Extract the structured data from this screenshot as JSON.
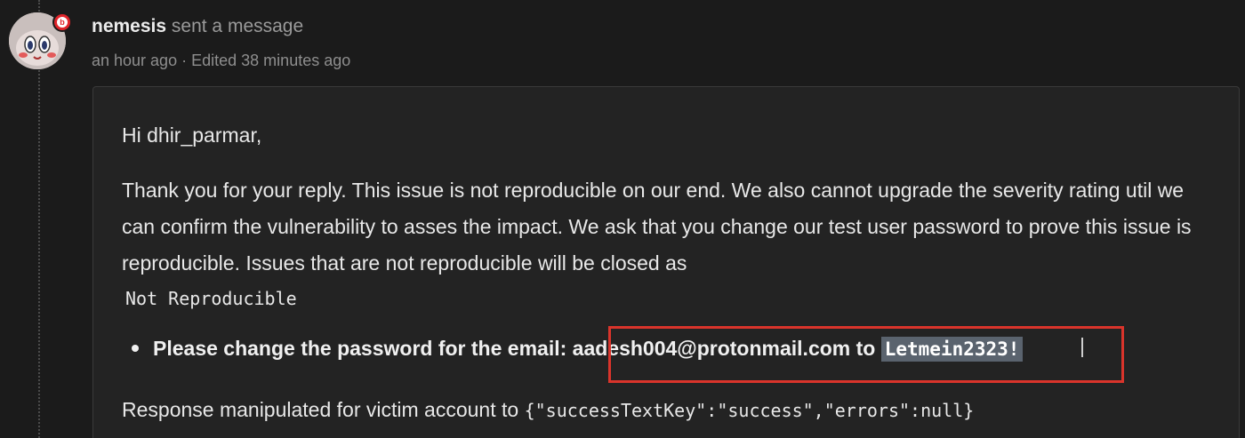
{
  "header": {
    "author": "nemesis",
    "action": "sent a message",
    "time": "an hour ago",
    "separator": "·",
    "edited": "Edited 38 minutes ago"
  },
  "message": {
    "greeting": "Hi dhir_parmar,",
    "paragraph": "Thank you for your reply. This issue is not reproducible on our end. We also cannot upgrade the severity rating util we can confirm the vulnerability to asses the impact. We ask that you change our test user password to prove this issue is reproducible. Issues that are not reproducible will be closed as",
    "status_code": "Not Reproducible",
    "bullet_prefix": "Please change the password for the email:",
    "email": "aadesh004@protonmail.com",
    "to_word": "to",
    "password": "Letmein2323!",
    "response_prefix": "Response manipulated for victim account to",
    "response_code": "{\"successTextKey\":\"success\",\"errors\":null}"
  },
  "colors": {
    "background": "#1b1b1b",
    "message_box": "#232323",
    "highlight_border": "#d9342b",
    "badge": "#e0242a"
  }
}
